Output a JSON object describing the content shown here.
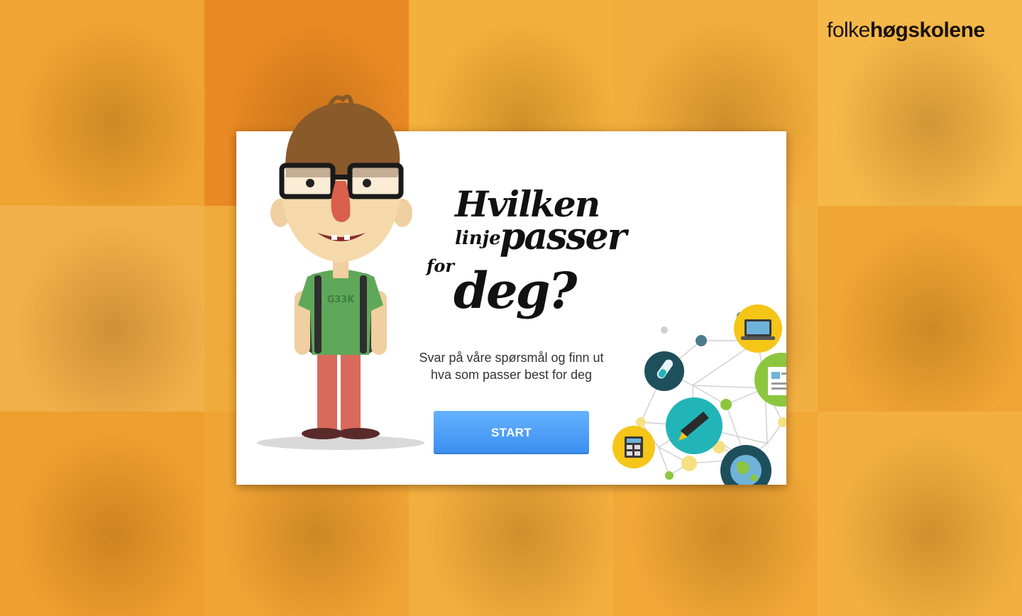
{
  "brand": {
    "logo_light": "folke",
    "logo_bold": "høgskolene"
  },
  "hero": {
    "title_words": [
      "Hvilken",
      "linje",
      "passer",
      "for",
      "deg?"
    ],
    "subtitle": "Svar på våre spørsmål og finn ut hva som passer best for deg",
    "start_label": "START"
  },
  "mascot": {
    "shirt_text": "G33K"
  },
  "colors": {
    "accent_orange": "#f2a92e",
    "button_blue": "#4a9ef5",
    "card_bg": "#ffffff",
    "icon_yellow": "#f5c518",
    "icon_teal": "#22b5b8",
    "icon_dark_teal": "#1e4f5c",
    "icon_green": "#8cc63f"
  },
  "icons": [
    "laptop-icon",
    "test-tube-icon",
    "document-icon",
    "pencil-icon",
    "calculator-icon",
    "globe-icon"
  ]
}
